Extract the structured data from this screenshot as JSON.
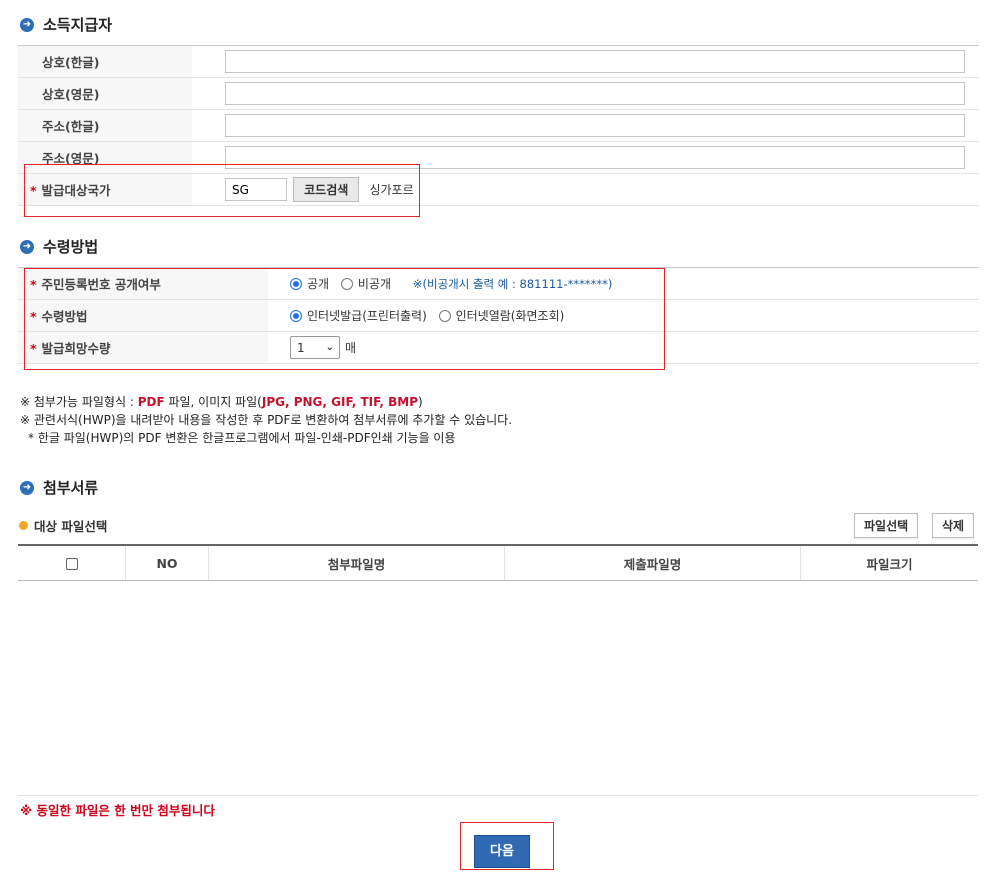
{
  "payer_section": {
    "title": "소득지급자",
    "rows": {
      "name_kr_label": "상호(한글)",
      "name_kr_value": "",
      "name_en_label": "상호(영문)",
      "name_en_value": "",
      "addr_kr_label": "주소(한글)",
      "addr_kr_value": "",
      "addr_en_label": "주소(영문)",
      "addr_en_value": "",
      "country_label": "발급대상국가",
      "country_code": "SG",
      "code_search_button": "코드검색",
      "country_name": "싱가포르"
    }
  },
  "receive_section": {
    "title": "수령방법",
    "id_disclosure_label": "주민등록번호 공개여부",
    "id_disclosure_options": [
      "공개",
      "비공개"
    ],
    "id_disclosure_selected": "공개",
    "id_disclosure_note": "※(비공개시 출력 예 : 881111-*******)",
    "method_label": "수령방법",
    "method_options": [
      "인터넷발급(프린터출력)",
      "인터넷열람(화면조회)"
    ],
    "method_selected": "인터넷발급(프린터출력)",
    "quantity_label": "발급희망수량",
    "quantity_value": "1",
    "quantity_unit": "매"
  },
  "notes": {
    "line1_prefix": "※ 첨부가능 파일형식 : ",
    "line1_pdf": "PDF",
    "line1_mid": " 파일, 이미지 파일(",
    "line1_types": "JPG, PNG, GIF, TIF, BMP",
    "line1_end": ")",
    "line2": "※ 관련서식(HWP)을 내려받아 내용을 작성한 후 PDF로 변환하여 첨부서류에 추가할 수 있습니다.",
    "line3": "* 한글 파일(HWP)의 PDF 변환은 한글프로그램에서 파일-인쇄-PDF인쇄 기능을 이용"
  },
  "attach_section": {
    "title": "첨부서류",
    "subtitle": "대상 파일선택",
    "select_button": "파일선택",
    "delete_button": "삭제",
    "columns": [
      "NO",
      "첨부파일명",
      "제출파일명",
      "파일크기"
    ],
    "warning": "※ 동일한 파일은 한 번만 첨부됩니다"
  },
  "next_button": "다음",
  "colors": {
    "accent_blue": "#2f6ab3",
    "required_red": "#d0021b",
    "highlight_box": "#e0242a"
  }
}
